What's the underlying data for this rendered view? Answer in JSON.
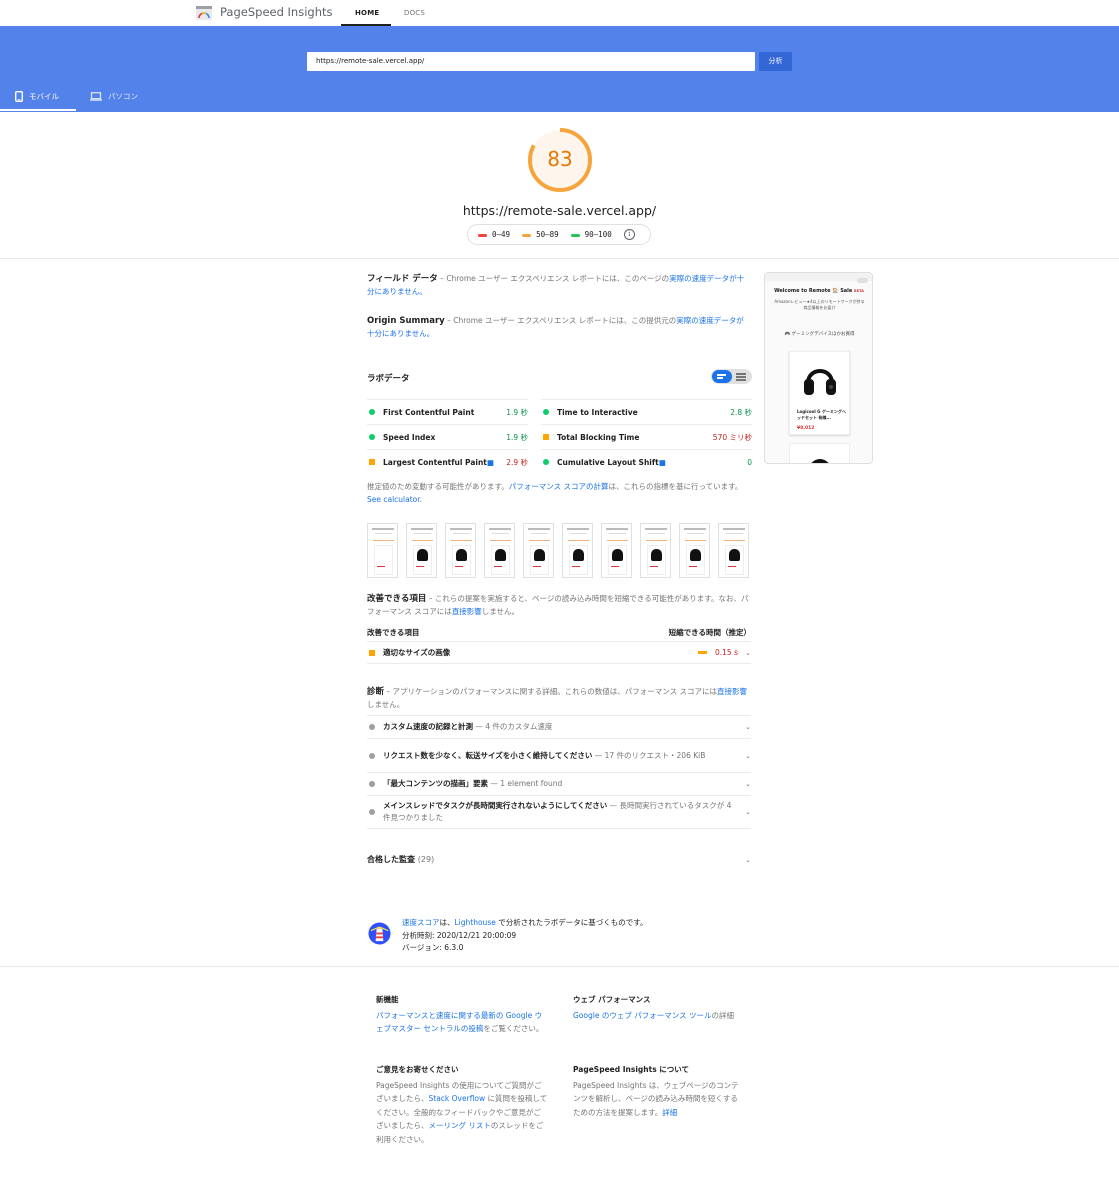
{
  "header": {
    "brand": "PageSpeed Insights",
    "tab_home": "HOME",
    "tab_docs": "DOCS"
  },
  "search": {
    "url": "https://remote-sale.vercel.app/",
    "analyze_label": "分析"
  },
  "devices": {
    "mobile": "モバイル",
    "desktop": "パソコン",
    "selected": "mobile"
  },
  "score": {
    "value": "83",
    "fraction": 0.83,
    "color": "#e67700",
    "tested_url": "https://remote-sale.vercel.app/"
  },
  "legend": {
    "bad": "0–49",
    "avg": "50–89",
    "good": "90–100",
    "colors": {
      "bad": "#f4443f",
      "avg": "#f7a43c",
      "good": "#23c45a"
    }
  },
  "field": {
    "title": "フィールド データ",
    "desc_prefix": " – Chrome ユーザー エクスペリエンス レポートには、このページの",
    "desc_link": "実際の速度データが十分にありません。",
    "origin_title": "Origin Summary",
    "origin_prefix": " – Chrome ユーザー エクスペリエンス レポートには、この提供元の",
    "origin_link": "実際の速度データが十分にありません。"
  },
  "lab": {
    "title": "ラボデータ",
    "metrics_left": [
      {
        "label": "First Contentful Paint",
        "value": "1.9 秒",
        "status": "good"
      },
      {
        "label": "Speed Index",
        "value": "1.9 秒",
        "status": "good"
      },
      {
        "label": "Largest Contentful Paint",
        "value": "2.9 秒",
        "status": "avg"
      }
    ],
    "metrics_right": [
      {
        "label": "Time to Interactive",
        "value": "2.8 秒",
        "status": "good"
      },
      {
        "label": "Total Blocking Time",
        "value": "570 ミリ秒",
        "status": "avg"
      },
      {
        "label": "Cumulative Layout Shift",
        "value": "0",
        "status": "good"
      }
    ],
    "note_prefix": "推定値のため変動する可能性があります。",
    "note_link": "パフォーマンス スコアの計算",
    "note_mid": "は、これらの指標を基に行っています。",
    "note_calc": "See calculator."
  },
  "opportunities": {
    "title": "改善できる項目",
    "desc_prefix": " – これらの提案を実施すると、ページの読み込み時間を短縮できる可能性があります。なお、パフォーマンス スコアには",
    "desc_link": "直接影響",
    "desc_suffix": "しません。",
    "col_item": "改善できる項目",
    "col_saving": "短縮できる時間（推定）",
    "items": [
      {
        "label": "適切なサイズの画像",
        "saving": "0.15 s"
      }
    ]
  },
  "diagnostics": {
    "title": "診断",
    "desc_prefix": " – アプリケーションのパフォーマンスに関する詳細。これらの数値は、パフォーマンス スコアには",
    "desc_link": "直接影響",
    "desc_suffix": "しません。",
    "items": [
      {
        "label": "カスタム速度の記録と計測",
        "sub": " — 4 件のカスタム速度"
      },
      {
        "label": "リクエスト数を少なく、転送サイズを小さく維持してください",
        "sub": " — 17 件のリクエスト・206 KiB"
      },
      {
        "label": "「最大コンテンツの描画」要素",
        "sub": " — 1 element found"
      },
      {
        "label": "メインスレッドでタスクが長時間実行されないようにしてください",
        "sub": " — 長時間実行されているタスクが 4 件見つかりました"
      }
    ]
  },
  "passed": {
    "title": "合格した監査",
    "count": "(29)"
  },
  "lighthouse": {
    "link1": "速度スコア",
    "mid": "は、",
    "link2": "Lighthouse",
    "suffix": " で分析されたラボデータに基づくものです。",
    "time": "分析時刻: 2020/12/21 20:00:09",
    "version": "バージョン: 6.3.0"
  },
  "preview": {
    "title": "Welcome to Remote 🏠 Sale",
    "badge": "BETA",
    "subtitle": "Amazonレビュー★4以上のリモートワークが捗る商品情報をお届け",
    "category": "🎮 ゲーミングデバイスほかお買得",
    "product": "Logicool G ゲーミングヘッドセット 有線...",
    "price": "¥8,012"
  },
  "footer": {
    "news_title": "新機能",
    "news_link": "パフォーマンスと速度に関する最新の Google ウェブマスター セントラルの投稿",
    "news_suffix": "をご覧ください。",
    "feedback_title": "ご意見をお寄せください",
    "feedback_prefix": "PageSpeed Insights の使用についてご質問がございましたら、",
    "feedback_link1": "Stack Overflow",
    "feedback_mid": " に質問を投稿してください。全般的なフィードバックやご意見がございましたら、",
    "feedback_link2": "メーリング リスト",
    "feedback_suffix": "のスレッドをご利用ください。",
    "webperf_title": "ウェブ パフォーマンス",
    "webperf_link": "Google のウェブ パフォーマンス ツール",
    "webperf_suffix": "の詳細",
    "about_title": "PageSpeed Insights について",
    "about_text": "PageSpeed Insights は、ウェブページのコンテンツを解析し、ページの読み込み時間を短くするための方法を提案します。",
    "about_link": "詳細"
  }
}
